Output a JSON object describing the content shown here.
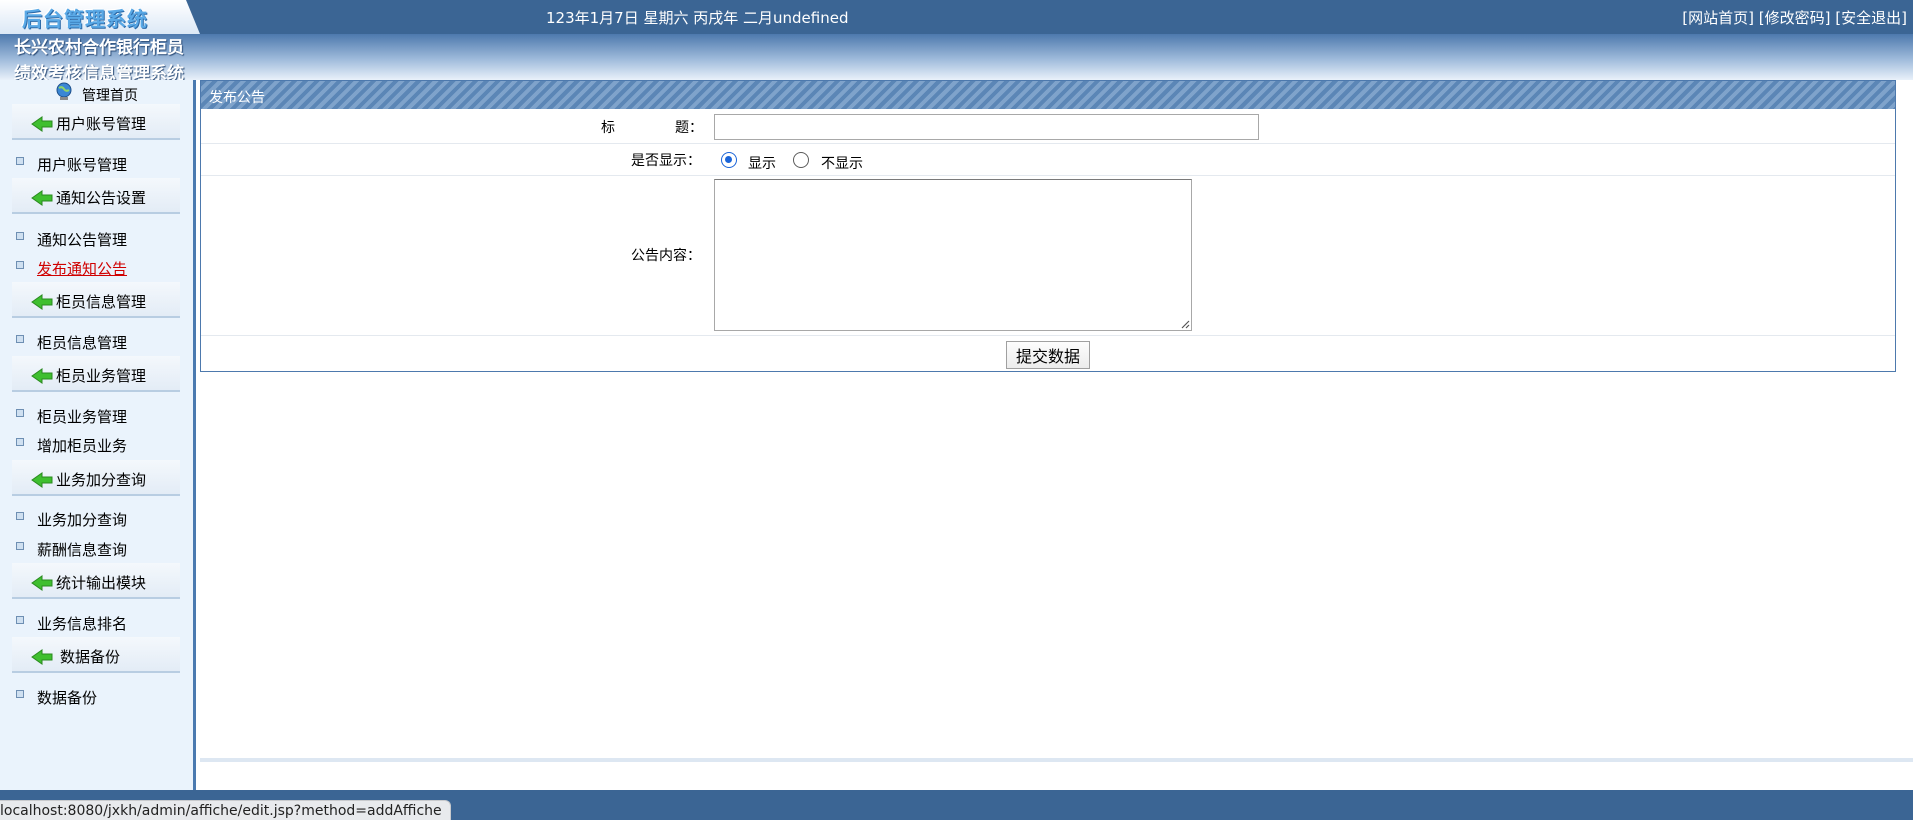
{
  "header": {
    "logo_text": "后台管理系统",
    "date_text": "123年1月7日 星期六 丙戌年 二月undefined",
    "links": [
      "[网站首页]",
      "[修改密码]",
      "[安全退出]"
    ]
  },
  "banner": {
    "title_line1": "长兴农村合作银行柜员",
    "title_line2": "绩效考核信息管理系统"
  },
  "sidebar": {
    "home_label": "管理首页",
    "groups": [
      {
        "label": "用户账号管理",
        "items": [
          "用户账号管理"
        ]
      },
      {
        "label": "通知公告设置",
        "items": [
          "通知公告管理",
          "发布通知公告"
        ]
      },
      {
        "label": "柜员信息管理",
        "items": [
          "柜员信息管理"
        ]
      },
      {
        "label": "柜员业务管理",
        "items": [
          "柜员业务管理",
          "增加柜员业务"
        ]
      },
      {
        "label": "业务加分查询",
        "items": [
          "业务加分查询",
          "薪酬信息查询"
        ]
      },
      {
        "label": "统计输出模块",
        "items": [
          "业务信息排名"
        ]
      },
      {
        "label": "数据备份",
        "items": [
          "数据备份"
        ]
      }
    ],
    "active_item": "发布通知公告"
  },
  "form": {
    "panel_title": "发布公告",
    "title_label_a": "标",
    "title_label_b": "题：",
    "title_value": "",
    "display_label": "是否显示：",
    "option_show": "显示",
    "option_hide": "不显示",
    "selected_option": "显示",
    "content_label": "公告内容：",
    "content_value": "",
    "submit_label": "提交数据"
  },
  "status_bar": {
    "url": "localhost:8080/jxkh/admin/affiche/edit.jsp?method=addAffiche"
  },
  "colors": {
    "topbar": "#3b6594",
    "sidebar_bg": "#eaf3fc",
    "active_link": "#d00000",
    "radio_accent": "#1a64d8"
  }
}
